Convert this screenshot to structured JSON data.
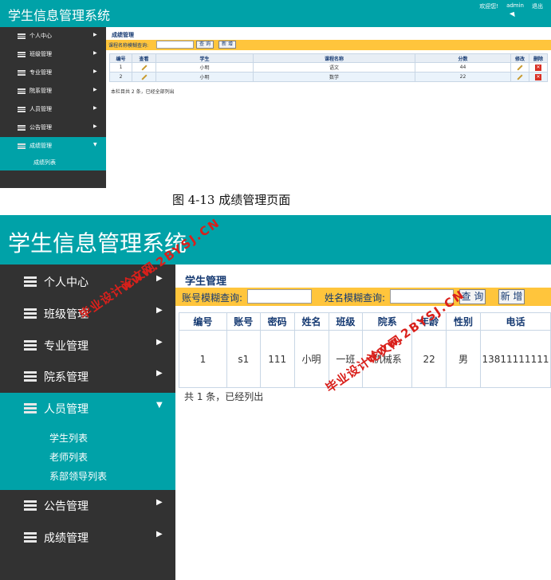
{
  "shot1": {
    "app_title": "学生信息管理系统",
    "top_links": [
      "欢迎您!",
      "admin",
      "退出"
    ],
    "sidebar": {
      "items": [
        {
          "label": "个人中心"
        },
        {
          "label": "班级管理"
        },
        {
          "label": "专业管理"
        },
        {
          "label": "院系管理"
        },
        {
          "label": "人员管理"
        },
        {
          "label": "公告管理"
        },
        {
          "label": "成绩管理",
          "expanded": true
        }
      ],
      "subitems": [
        "成绩列表"
      ]
    },
    "page_title": "成绩管理",
    "search": {
      "label": "课程名称模糊查询:",
      "value": "",
      "query_button": "查 询",
      "add_button": "新 增"
    },
    "table": {
      "headers": [
        "编号",
        "查看",
        "学生",
        "课程名称",
        "分数",
        "修改",
        "删除"
      ],
      "rows": [
        {
          "id": "1",
          "student": "小明",
          "course": "语文",
          "score": "44"
        },
        {
          "id": "2",
          "student": "小明",
          "course": "数学",
          "score": "22"
        }
      ]
    },
    "footer": "本栏目共 2 条，已经全部列出"
  },
  "caption": "图 4-13  成绩管理页面",
  "shot2": {
    "app_title": "学生信息管理系统",
    "sidebar": {
      "items": [
        {
          "label": "个人中心"
        },
        {
          "label": "班级管理"
        },
        {
          "label": "专业管理"
        },
        {
          "label": "院系管理"
        },
        {
          "label": "人员管理",
          "expanded": true
        },
        {
          "label": "公告管理"
        },
        {
          "label": "成绩管理"
        }
      ],
      "subitems": [
        "学生列表",
        "老师列表",
        "系部领导列表"
      ]
    },
    "page_title": "学生管理",
    "search": {
      "account_label": "账号模糊查询:",
      "name_label": "姓名模糊查询:",
      "account_value": "",
      "name_value": "",
      "query_button": "查 询",
      "add_button": "新 增"
    },
    "table": {
      "headers": [
        "编号",
        "账号",
        "密码",
        "姓名",
        "班级",
        "院系",
        "年龄",
        "性别",
        "电话"
      ],
      "rows": [
        {
          "id": "1",
          "account": "s1",
          "password": "111",
          "name": "小明",
          "class": "一班",
          "department": "机械系",
          "age": "22",
          "gender": "男",
          "phone": "13811111111"
        }
      ]
    },
    "footer": "共 1 条，已经列出"
  },
  "watermark": {
    "text": "毕业设计论文网",
    "url": "www.2BYSJ.CN",
    "color": "#d9201b"
  },
  "colors": {
    "teal": "#00a2a8",
    "sidebar": "#323232",
    "search_bar": "#ffc53c",
    "title_blue": "#163a72"
  }
}
